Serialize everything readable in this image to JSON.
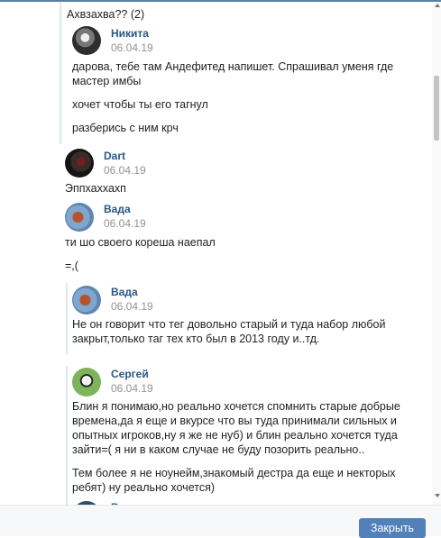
{
  "thread": {
    "header_text": "Ахвзахва?? (2)",
    "msg1": {
      "author": "Никита",
      "date": "06.04.19",
      "lines": [
        "дарова, тебе там Андефитед напишет. Спрашивал уменя где",
        "мастер имбы"
      ],
      "line2": "хочет чтобы ты его тагнул",
      "line3": "разберись с ним крч"
    },
    "msg2": {
      "author": "Dart",
      "date": "06.04.19",
      "text": "Эппхаххахп"
    },
    "msg3": {
      "author": "Вада",
      "date": "06.04.19",
      "text": "ти шо своего кореша наепал",
      "text2": "=,("
    },
    "msg4": {
      "author": "Вада",
      "date": "06.04.19",
      "lines": [
        "Не он говорит что тег довольно старый и туда набор любой",
        "закрыт,только таг тех кто был в 2013 году и..тд."
      ]
    },
    "msg5": {
      "author": "Сергей",
      "date": "06.04.19",
      "lines": [
        "Блин я понимаю,но реально хочется спомнить старые добрые",
        "времена,да я еще и вкурсе что вы туда принимали сильных и",
        "опытных игроков,ну я же не нуб) и блин реально хочется туда",
        "зайти=( я ни в каком случае не буду позорить реально.."
      ],
      "lines2": [
        "Тем более я не ноунейм,знакомый деcтра да еще и некторых",
        "ребят) ну реально хочется)"
      ]
    },
    "msg6_partial_author": "В"
  },
  "footer": {
    "close_label": "Закрыть"
  }
}
